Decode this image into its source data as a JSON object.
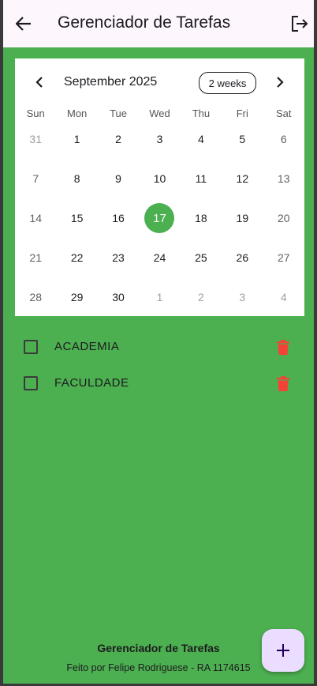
{
  "appbar": {
    "title": "Gerenciador de Tarefas",
    "back_icon": "arrow-left-icon",
    "logout_icon": "logout-icon"
  },
  "calendar": {
    "month_label": "September 2025",
    "format_button": "2 weeks",
    "weekdays": [
      "Sun",
      "Mon",
      "Tue",
      "Wed",
      "Thu",
      "Fri",
      "Sat"
    ],
    "weeks": [
      [
        "31",
        "1",
        "2",
        "3",
        "4",
        "5",
        "6"
      ],
      [
        "7",
        "8",
        "9",
        "10",
        "11",
        "12",
        "13"
      ],
      [
        "14",
        "15",
        "16",
        "17",
        "18",
        "19",
        "20"
      ],
      [
        "21",
        "22",
        "23",
        "24",
        "25",
        "26",
        "27"
      ],
      [
        "28",
        "29",
        "30",
        "1",
        "2",
        "3",
        "4"
      ]
    ],
    "selected_day": "17",
    "selected_color": "#4caf50"
  },
  "tasks": [
    {
      "label": "ACADEMIA",
      "checked": false
    },
    {
      "label": "FACULDADE",
      "checked": false
    }
  ],
  "footer": {
    "title": "Gerenciador de Tarefas",
    "subtitle": "Feito por Felipe Rodriguese - RA 1174615"
  },
  "fab": {
    "icon": "plus-icon"
  },
  "colors": {
    "background": "#4caf50",
    "appbar": "#fdf6fd",
    "trash": "#f44336",
    "fab": "#eaddff"
  }
}
